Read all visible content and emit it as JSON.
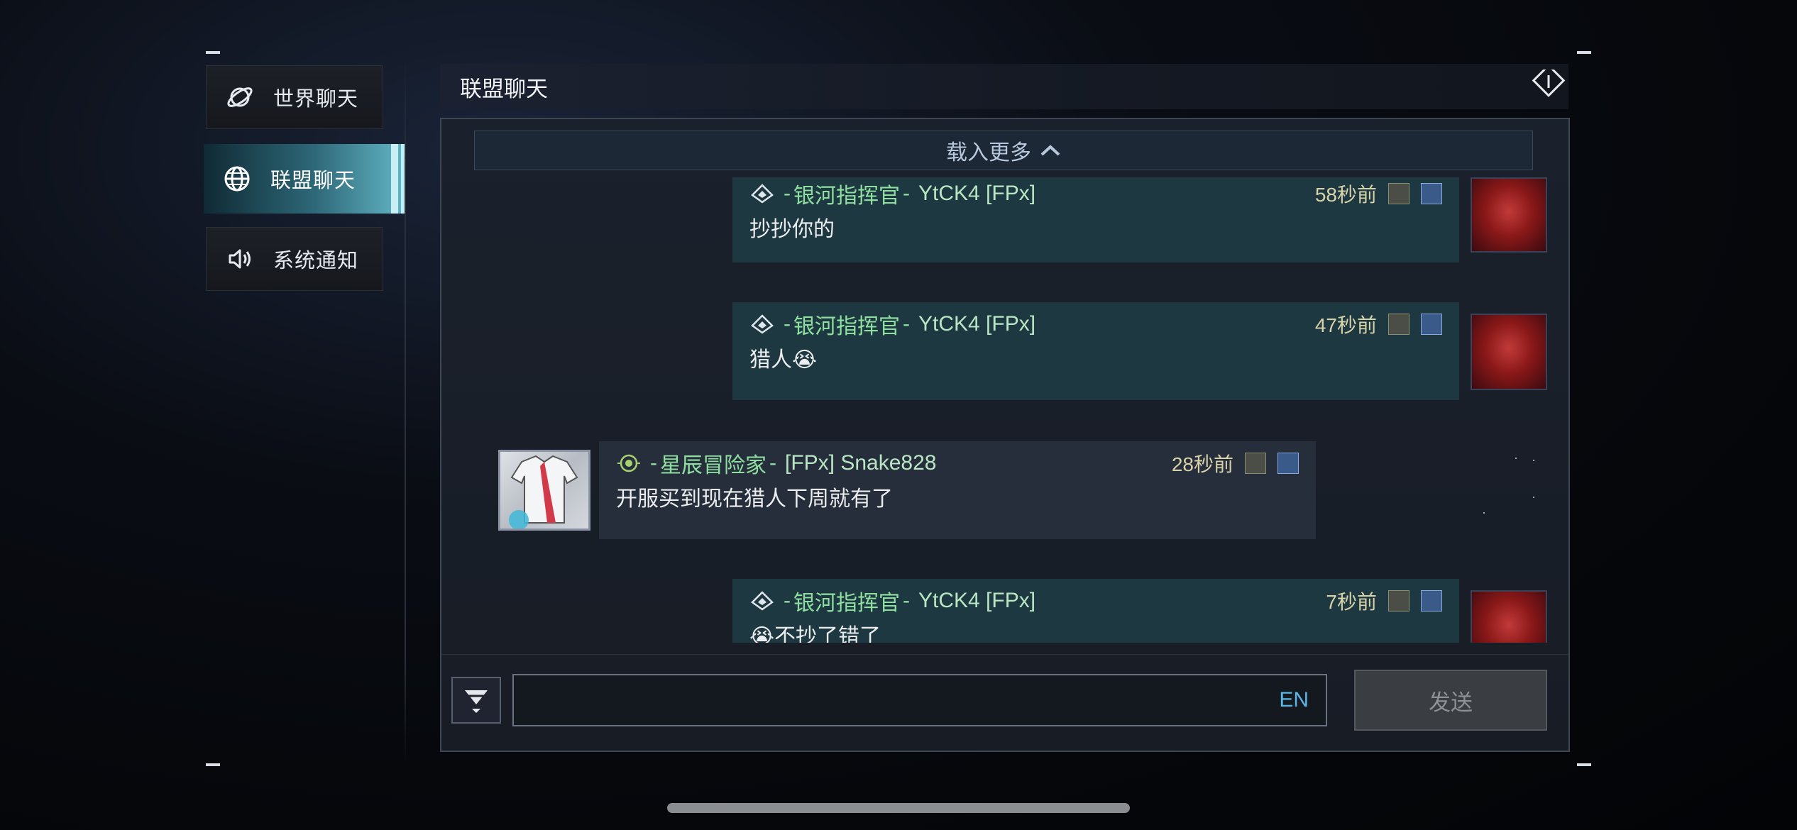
{
  "sidebar": {
    "items": [
      {
        "label": "世界聊天",
        "icon": "planet-icon",
        "active": false
      },
      {
        "label": "联盟聊天",
        "icon": "globe-icon",
        "active": true
      },
      {
        "label": "系统通知",
        "icon": "speaker-icon",
        "active": false
      }
    ]
  },
  "header": {
    "title": "联盟聊天",
    "exit_icon": "exit-icon"
  },
  "load_more": {
    "label": "载入更多"
  },
  "messages": [
    {
      "side": "self",
      "rank": "银河指挥官",
      "user": "YtCK4 [FPx]",
      "time": "58秒前",
      "text": "抄抄你的"
    },
    {
      "side": "self",
      "rank": "银河指挥官",
      "user": "YtCK4 [FPx]",
      "time": "47秒前",
      "text": "猎人😭"
    },
    {
      "side": "other",
      "rank": "星辰冒险家",
      "user": "[FPx] Snake828",
      "time": "28秒前",
      "text": "开服买到现在猎人下周就有了"
    },
    {
      "side": "self",
      "rank": "银河指挥官",
      "user": "YtCK4 [FPx]",
      "time": "7秒前",
      "text": "😭不抄了错了"
    }
  ],
  "input": {
    "value": "",
    "lang": "EN"
  },
  "send": {
    "label": "发送"
  },
  "colors": {
    "accent": "#62b6c6",
    "rank_green": "#8fe0a0",
    "time": "#d8d2a8",
    "lang": "#5bb6e8"
  }
}
